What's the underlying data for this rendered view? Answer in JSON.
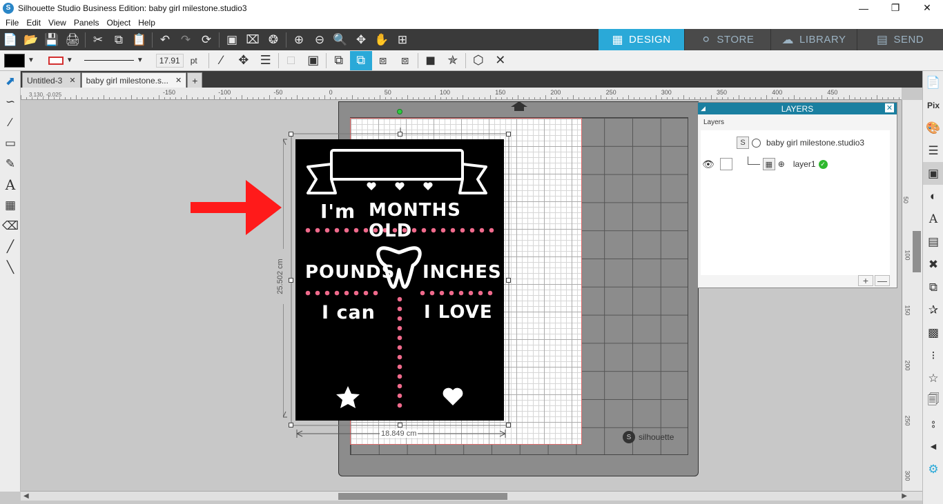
{
  "window": {
    "title": "Silhouette Studio Business Edition: baby girl milestone.studio3",
    "minimize": "—",
    "restore": "❐",
    "close": "✕"
  },
  "menu": [
    "File",
    "Edit",
    "View",
    "Panels",
    "Object",
    "Help"
  ],
  "mode_tabs": [
    {
      "label": "DESIGN",
      "icon": "grid-icon"
    },
    {
      "label": "STORE",
      "icon": "silhouette-s-icon"
    },
    {
      "label": "LIBRARY",
      "icon": "cloud-icon"
    },
    {
      "label": "SEND",
      "icon": "cutter-icon"
    }
  ],
  "style_toolbar": {
    "fill_color": "#000000",
    "line_color": "#d32f2f",
    "line_width": "17.91",
    "line_unit": "pt"
  },
  "doc_tabs": {
    "tab1": "Untitled-3",
    "tab2": "baby girl milestone.s...",
    "close": "✕",
    "add": "+"
  },
  "rulers": {
    "h_ticks": [
      "-150",
      "-100",
      "-50",
      "0",
      "50",
      "100",
      "150",
      "200",
      "250",
      "300",
      "350",
      "400",
      "450"
    ],
    "v_ticks": [
      "50",
      "100",
      "150",
      "200",
      "250",
      "300"
    ],
    "coord_readout": "3.130, -0.025"
  },
  "selection": {
    "width": "18.849 cm",
    "height": "25.502 cm"
  },
  "artwork": {
    "line1_left": "I'm",
    "line1_right": "MONTHS OLD",
    "line2_left": "POUNDS",
    "line2_right": "INCHES",
    "line3_left": "I can",
    "line3_right": "I LOVE"
  },
  "mat": {
    "brand": "silhouette"
  },
  "layers_panel": {
    "title": "LAYERS",
    "section": "Layers",
    "document_name": "baby girl milestone.studio3",
    "layer_name": "layer1",
    "add_label": "+",
    "remove_label": "—"
  },
  "colors": {
    "accent": "#2aa9d8",
    "panel_header": "#1a7fa0",
    "dots_pink": "#f06a8c",
    "arrow_red": "#ff1a1a"
  }
}
